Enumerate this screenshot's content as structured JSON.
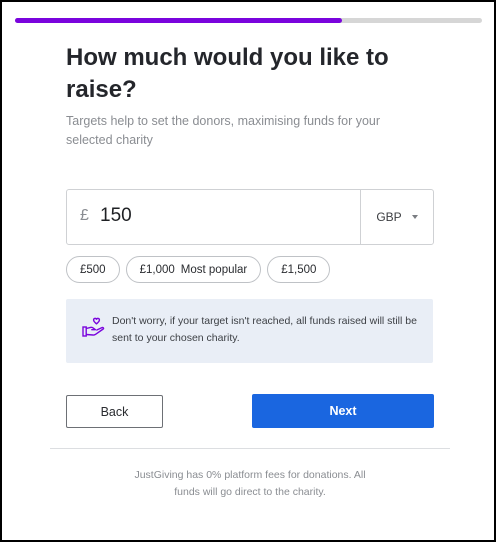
{
  "progress": {
    "fraction": 0.7
  },
  "header": {
    "title": "How much would you like to raise?",
    "subtitle": "Targets help to set the donors, maximising funds for your selected charity"
  },
  "amount": {
    "currency_symbol": "£",
    "value": "150",
    "currency": "GBP"
  },
  "presets": [
    {
      "amount": "£500",
      "tag": ""
    },
    {
      "amount": "£1,000",
      "tag": "Most popular"
    },
    {
      "amount": "£1,500",
      "tag": ""
    }
  ],
  "info": {
    "icon": "hand-heart-icon",
    "icon_color": "#7a04dd",
    "text": "Don't worry, if your target isn't reached, all funds raised will still be sent to your chosen charity."
  },
  "actions": {
    "back_label": "Back",
    "next_label": "Next"
  },
  "footer": {
    "note": "JustGiving has 0% platform fees for donations. All funds will go direct to the charity."
  },
  "colors": {
    "accent": "#7a04dd",
    "primary": "#1a66e0",
    "info_bg": "#e9eef6"
  }
}
